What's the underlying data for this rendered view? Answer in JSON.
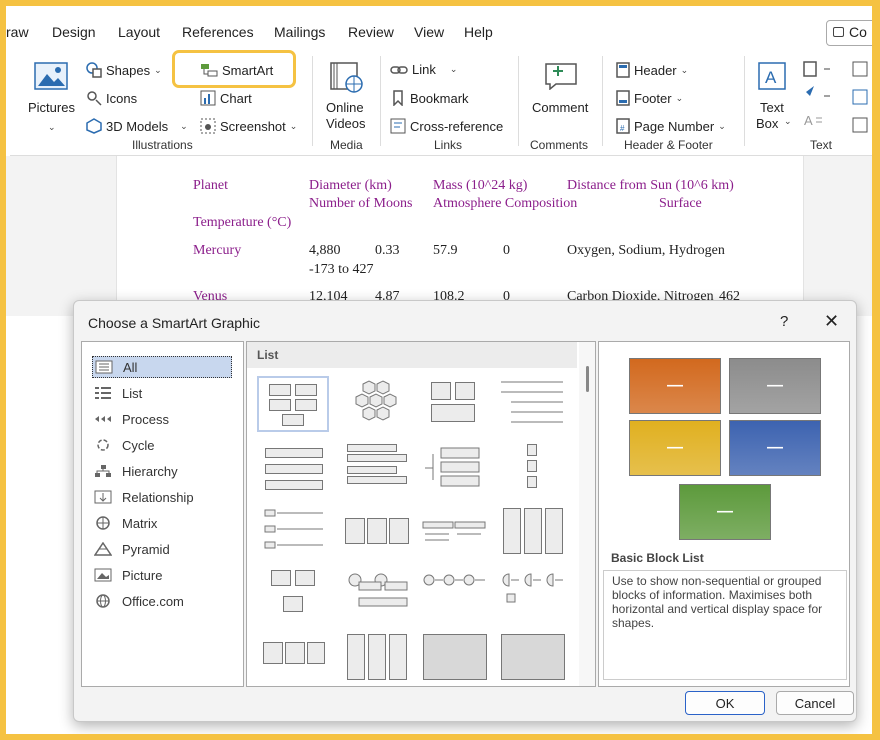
{
  "menu": {
    "tabs": [
      "raw",
      "Design",
      "Layout",
      "References",
      "Mailings",
      "Review",
      "View",
      "Help"
    ],
    "share_label": "Co"
  },
  "ribbon": {
    "illustrations": {
      "pictures": "Pictures",
      "shapes": "Shapes",
      "icons": "Icons",
      "models": "3D Models",
      "smartart": "SmartArt",
      "chart": "Chart",
      "screenshot": "Screenshot",
      "group": "Illustrations"
    },
    "media": {
      "online_videos_1": "Online",
      "online_videos_2": "Videos",
      "group": "Media"
    },
    "links": {
      "link": "Link",
      "bookmark": "Bookmark",
      "cross_reference": "Cross-reference",
      "group": "Links"
    },
    "comments": {
      "comment": "Comment",
      "group": "Comments"
    },
    "header_footer": {
      "header": "Header",
      "footer": "Footer",
      "page_number": "Page Number",
      "group": "Header & Footer"
    },
    "text": {
      "text_box_1": "Text",
      "text_box_2": "Box",
      "group": "Text"
    }
  },
  "document": {
    "headers": {
      "planet": "Planet",
      "diameter": "Diameter (km)",
      "mass": "Mass (10^24 kg)",
      "distance": "Distance from Sun (10^6 km)",
      "moons": "Number of Moons",
      "atmosphere": "Atmosphere Composition",
      "surface": "Surface",
      "temperature": "Temperature (°C)"
    },
    "rows": [
      {
        "planet": "Mercury",
        "diameter": "4,880",
        "mass": "0.33",
        "distance": "57.9",
        "moons": "0",
        "atmosphere": "Oxygen, Sodium, Hydrogen",
        "temp": "-173 to 427"
      },
      {
        "planet": "Venus",
        "diameter": "12,104",
        "mass": "4.87",
        "distance": "108.2",
        "moons": "0",
        "atmosphere": "Carbon Dioxide, Nitrogen",
        "temp": "462"
      }
    ]
  },
  "dialog": {
    "title": "Choose a SmartArt Graphic",
    "help": "?",
    "close": "✕",
    "categories": [
      "All",
      "List",
      "Process",
      "Cycle",
      "Hierarchy",
      "Relationship",
      "Matrix",
      "Pyramid",
      "Picture",
      "Office.com"
    ],
    "gallery_header": "List",
    "preview": {
      "title": "Basic Block List",
      "description": "Use to show non-sequential or grouped blocks of information. Maximises both horizontal and vertical display space for shapes.",
      "block_colors": [
        "#d2691e",
        "#8c8c8c",
        "#e0b020",
        "#3d63b0",
        "#5d9a3c"
      ]
    },
    "ok": "OK",
    "cancel": "Cancel"
  }
}
